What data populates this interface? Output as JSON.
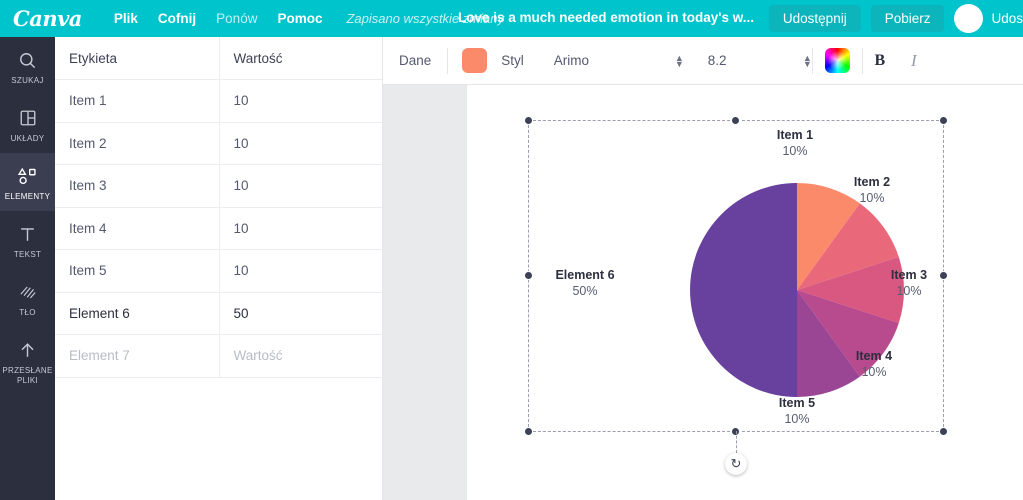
{
  "topbar": {
    "logo": "Canva",
    "menu": [
      {
        "label": "Plik",
        "dim": false
      },
      {
        "label": "Cofnij",
        "dim": false
      },
      {
        "label": "Ponów",
        "dim": true
      },
      {
        "label": "Pomoc",
        "dim": false
      }
    ],
    "save_status": "Zapisano wszystkie zmiany",
    "doc_title": "Love is a much needed emotion in today's w...",
    "share_button": "Udostępnij",
    "download_button": "Pobierz",
    "user_name": "Udos",
    "accent_color": "#00c4cc"
  },
  "sidebar": {
    "items": [
      {
        "label": "SZUKAJ",
        "icon": "search-icon",
        "active": false
      },
      {
        "label": "UKŁADY",
        "icon": "layouts-icon",
        "active": false
      },
      {
        "label": "ELEMENTY",
        "icon": "elements-icon",
        "active": true
      },
      {
        "label": "TEKST",
        "icon": "text-icon",
        "active": false
      },
      {
        "label": "TŁO",
        "icon": "background-icon",
        "active": false
      },
      {
        "label": "PRZESŁANE PLIKI",
        "icon": "upload-icon",
        "active": false
      }
    ]
  },
  "data_panel": {
    "columns": [
      "Etykieta",
      "Wartość"
    ],
    "rows": [
      {
        "label": "Item 1",
        "value": "10",
        "placeholder": false
      },
      {
        "label": "Item 2",
        "value": "10",
        "placeholder": false
      },
      {
        "label": "Item 3",
        "value": "10",
        "placeholder": false
      },
      {
        "label": "Item 4",
        "value": "10",
        "placeholder": false
      },
      {
        "label": "Item 5",
        "value": "10",
        "placeholder": false
      },
      {
        "label": "Element 6",
        "value": "50",
        "placeholder": false,
        "strong": true
      },
      {
        "label": "Element 7",
        "value": "Wartość",
        "placeholder": true
      }
    ]
  },
  "toolbar": {
    "data_label": "Dane",
    "style_label": "Styl",
    "color_swatch": "#fb8a6b",
    "font_family": "Arimo",
    "font_size": "8.2",
    "rainbow_label": "color-picker",
    "bold_label": "B",
    "italic_label": "I"
  },
  "chart_data": {
    "type": "pie",
    "title": "",
    "categories": [
      "Item 1",
      "Item 2",
      "Item 3",
      "Item 4",
      "Item 5",
      "Element 6"
    ],
    "values": [
      10,
      10,
      10,
      10,
      10,
      50
    ],
    "percents": [
      "10%",
      "10%",
      "10%",
      "10%",
      "10%",
      "50%"
    ],
    "colors": [
      "#fb8a6b",
      "#e9697a",
      "#d95881",
      "#b84a8e",
      "#9b4695",
      "#68409d"
    ],
    "legend": "labels-outside",
    "start_angle_deg": 0,
    "labels": [
      {
        "name": "Item 1",
        "percent": "10%"
      },
      {
        "name": "Item 2",
        "percent": "10%"
      },
      {
        "name": "Item 3",
        "percent": "10%"
      },
      {
        "name": "Item 4",
        "percent": "10%"
      },
      {
        "name": "Item 5",
        "percent": "10%"
      },
      {
        "name": "Element 6",
        "percent": "50%"
      }
    ]
  },
  "canvas": {
    "rotate_handle": "↻"
  }
}
